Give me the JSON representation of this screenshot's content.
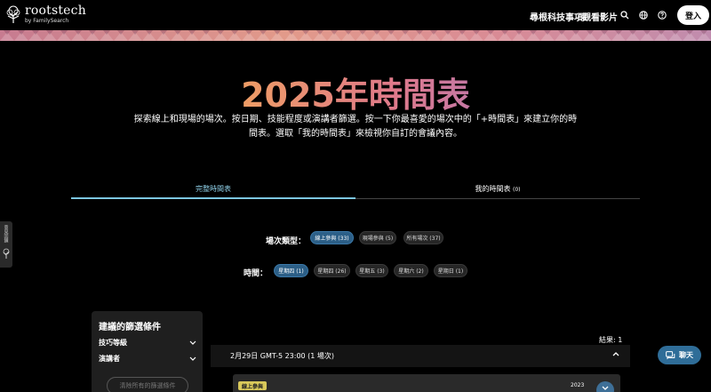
{
  "header": {
    "logo_main": "rootstech",
    "logo_sub": "by FamilySearch",
    "nav": [
      {
        "label": "尋根科技事項"
      },
      {
        "label": "觀看影片"
      }
    ],
    "login_label": "登入",
    "icons": [
      "search-icon",
      "globe-icon",
      "help-icon"
    ]
  },
  "hero": {
    "title": "2025年時間表",
    "description": "探索線上和現場的場次。按日期、技能程度或演講者篩選。按一下你最喜愛的場次中的「+時間表」來建立你的時間表。選取「我的時間表」來檢視你自訂的會議內容。"
  },
  "tabs": {
    "full": "完整時間表",
    "mine": "我的時間表",
    "mine_count": "(0)"
  },
  "filters": {
    "type_label": "場次類型：",
    "type_chips": [
      {
        "label": "線上參與 (33)",
        "selected": true
      },
      {
        "label": "現場參與 (5)",
        "selected": false
      },
      {
        "label": "所有場次 (37)",
        "selected": false
      }
    ],
    "time_label": "時間：",
    "time_chips": [
      {
        "label": "星期四 (1)",
        "selected": true
      },
      {
        "label": "星期四 (26)",
        "selected": false
      },
      {
        "label": "星期五 (3)",
        "selected": false
      },
      {
        "label": "星期六 (2)",
        "selected": false
      },
      {
        "label": "星期日 (1)",
        "selected": false
      }
    ]
  },
  "side_tab": {
    "label": "意見回饋"
  },
  "panel": {
    "title": "建議的篩選條件",
    "rows": [
      "技巧等級",
      "演講者"
    ],
    "clear_label": "清除所有的篩選條件"
  },
  "results": {
    "count_label": "結果: 1",
    "date_header": "2月29日 GMT-5 23:00 (1 場次)",
    "card": {
      "badge": "線上參與",
      "year": "2023"
    }
  },
  "chat": {
    "label": "聊天"
  },
  "colors": {
    "accent": "#2c5f87",
    "tab_active": "#7cc6e0",
    "badge": "#d8c85a"
  }
}
